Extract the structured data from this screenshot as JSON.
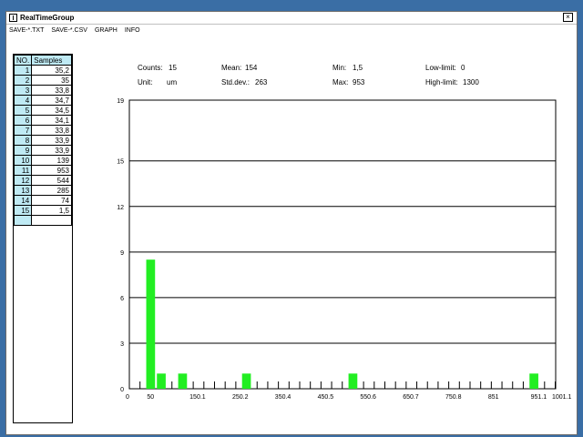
{
  "window": {
    "title": "RealTimeGroup",
    "close_label": "×"
  },
  "menu": [
    {
      "label": "SAVE-*.TXT"
    },
    {
      "label": "SAVE-*.CSV"
    },
    {
      "label": "GRAPH"
    },
    {
      "label": "INFO"
    }
  ],
  "table": {
    "headers": [
      "NO.",
      "Samples"
    ],
    "rows": [
      {
        "no": "1",
        "value": "35,2"
      },
      {
        "no": "2",
        "value": "35"
      },
      {
        "no": "3",
        "value": "33,8"
      },
      {
        "no": "4",
        "value": "34,7"
      },
      {
        "no": "5",
        "value": "34,5"
      },
      {
        "no": "6",
        "value": "34,1"
      },
      {
        "no": "7",
        "value": "33,8"
      },
      {
        "no": "8",
        "value": "33,9"
      },
      {
        "no": "9",
        "value": "33,9"
      },
      {
        "no": "10",
        "value": "139"
      },
      {
        "no": "11",
        "value": "953"
      },
      {
        "no": "12",
        "value": "544"
      },
      {
        "no": "13",
        "value": "285"
      },
      {
        "no": "14",
        "value": "74"
      },
      {
        "no": "15",
        "value": "1,5"
      }
    ]
  },
  "stats": {
    "counts_label": "Counts:",
    "counts_value": "15",
    "unit_label": "Unit:",
    "unit_value": "um",
    "mean_label": "Mean:",
    "mean_value": "154",
    "stddev_label": "Std.dev.:",
    "stddev_value": "263",
    "min_label": "Min:",
    "min_value": "1,5",
    "max_label": "Max:",
    "max_value": "953",
    "lowlimit_label": "Low-limit:",
    "lowlimit_value": "0",
    "highlimit_label": "High-limit:",
    "highlimit_value": "1300"
  },
  "colors": {
    "bar": "#22ee22",
    "accent": "#bfeaf4"
  },
  "chart_data": {
    "type": "bar",
    "xlim": [
      0,
      1001.1
    ],
    "ylim": [
      0,
      19
    ],
    "x_ticks": [
      "0",
      "50",
      "150.1",
      "250.2",
      "350.4",
      "450.5",
      "550.6",
      "650.7",
      "750.8",
      "851",
      "951.1",
      "1001.1"
    ],
    "x_tick_values": [
      0,
      50,
      150.1,
      250.2,
      350.4,
      450.5,
      550.6,
      650.7,
      750.8,
      851,
      951.1,
      1001.1
    ],
    "y_ticks": [
      "0",
      "3",
      "6",
      "9",
      "12",
      "15",
      "19"
    ],
    "y_tick_values": [
      0,
      3,
      6,
      9,
      12,
      15,
      19
    ],
    "bin_width": 25,
    "bins": [
      {
        "x": 50,
        "value": 8.5
      },
      {
        "x": 75,
        "value": 1
      },
      {
        "x": 125,
        "value": 1
      },
      {
        "x": 275,
        "value": 1
      },
      {
        "x": 525,
        "value": 1
      },
      {
        "x": 950,
        "value": 1
      }
    ],
    "grid": true
  }
}
